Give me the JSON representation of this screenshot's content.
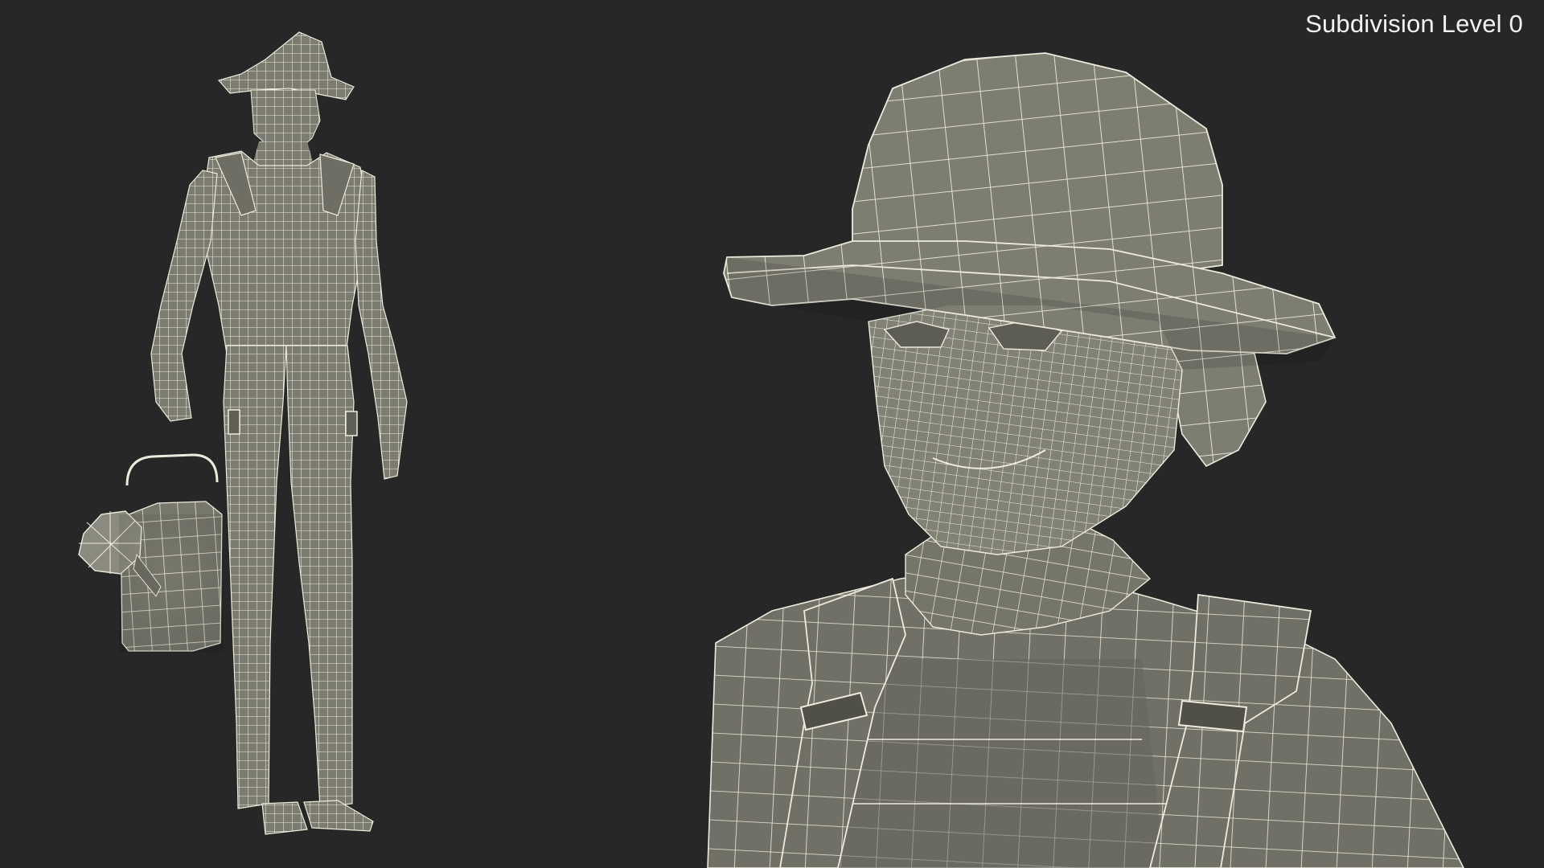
{
  "viewport": {
    "subdivision_label": "Subdivision Level 0"
  },
  "colors": {
    "background": "#272727",
    "mesh_fill": "#7d7d72",
    "mesh_fill_dark": "#5f5f56",
    "wire": "#ecebdc"
  }
}
